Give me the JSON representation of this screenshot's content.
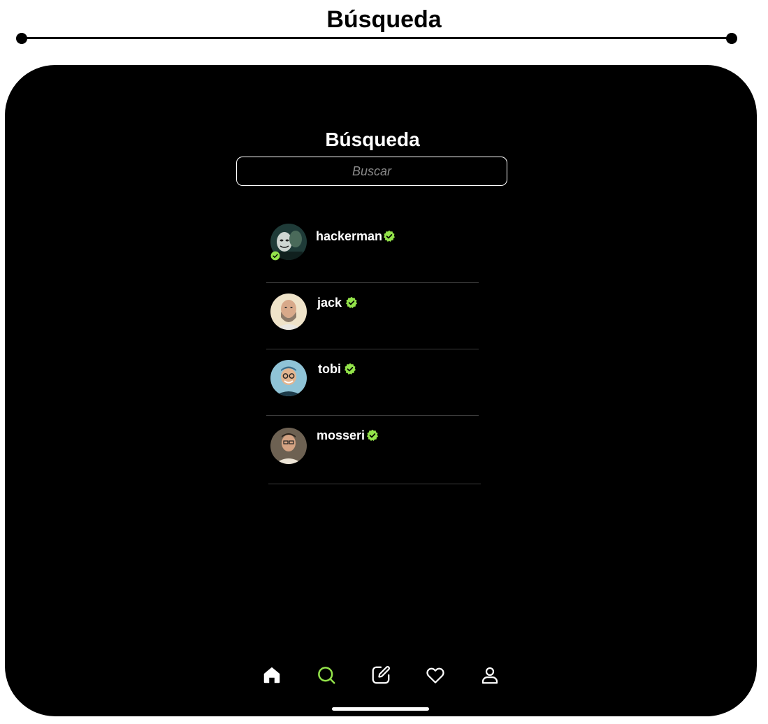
{
  "page": {
    "section_heading": "Búsqueda"
  },
  "screen": {
    "title": "Búsqueda",
    "search": {
      "placeholder": "Buscar",
      "value": ""
    }
  },
  "results": [
    {
      "username": "hackerman",
      "verified": true,
      "avatar": "hacker-mask-photo"
    },
    {
      "username": "jack",
      "verified": true,
      "avatar": "bearded-man-photo"
    },
    {
      "username": "tobi",
      "verified": true,
      "avatar": "smiling-man-glasses-photo"
    },
    {
      "username": "mosseri",
      "verified": true,
      "avatar": "man-glasses-shirt-photo"
    }
  ],
  "tabbar": {
    "tabs": [
      {
        "icon": "home-icon",
        "active": false
      },
      {
        "icon": "search-icon",
        "active": true
      },
      {
        "icon": "compose-icon",
        "active": false
      },
      {
        "icon": "heart-icon",
        "active": false
      },
      {
        "icon": "profile-icon",
        "active": false
      }
    ]
  },
  "colors": {
    "accent": "#93e34a",
    "background": "#000000",
    "text": "#ffffff",
    "divider": "#3b3b3b",
    "placeholder": "#8a8a8a"
  }
}
